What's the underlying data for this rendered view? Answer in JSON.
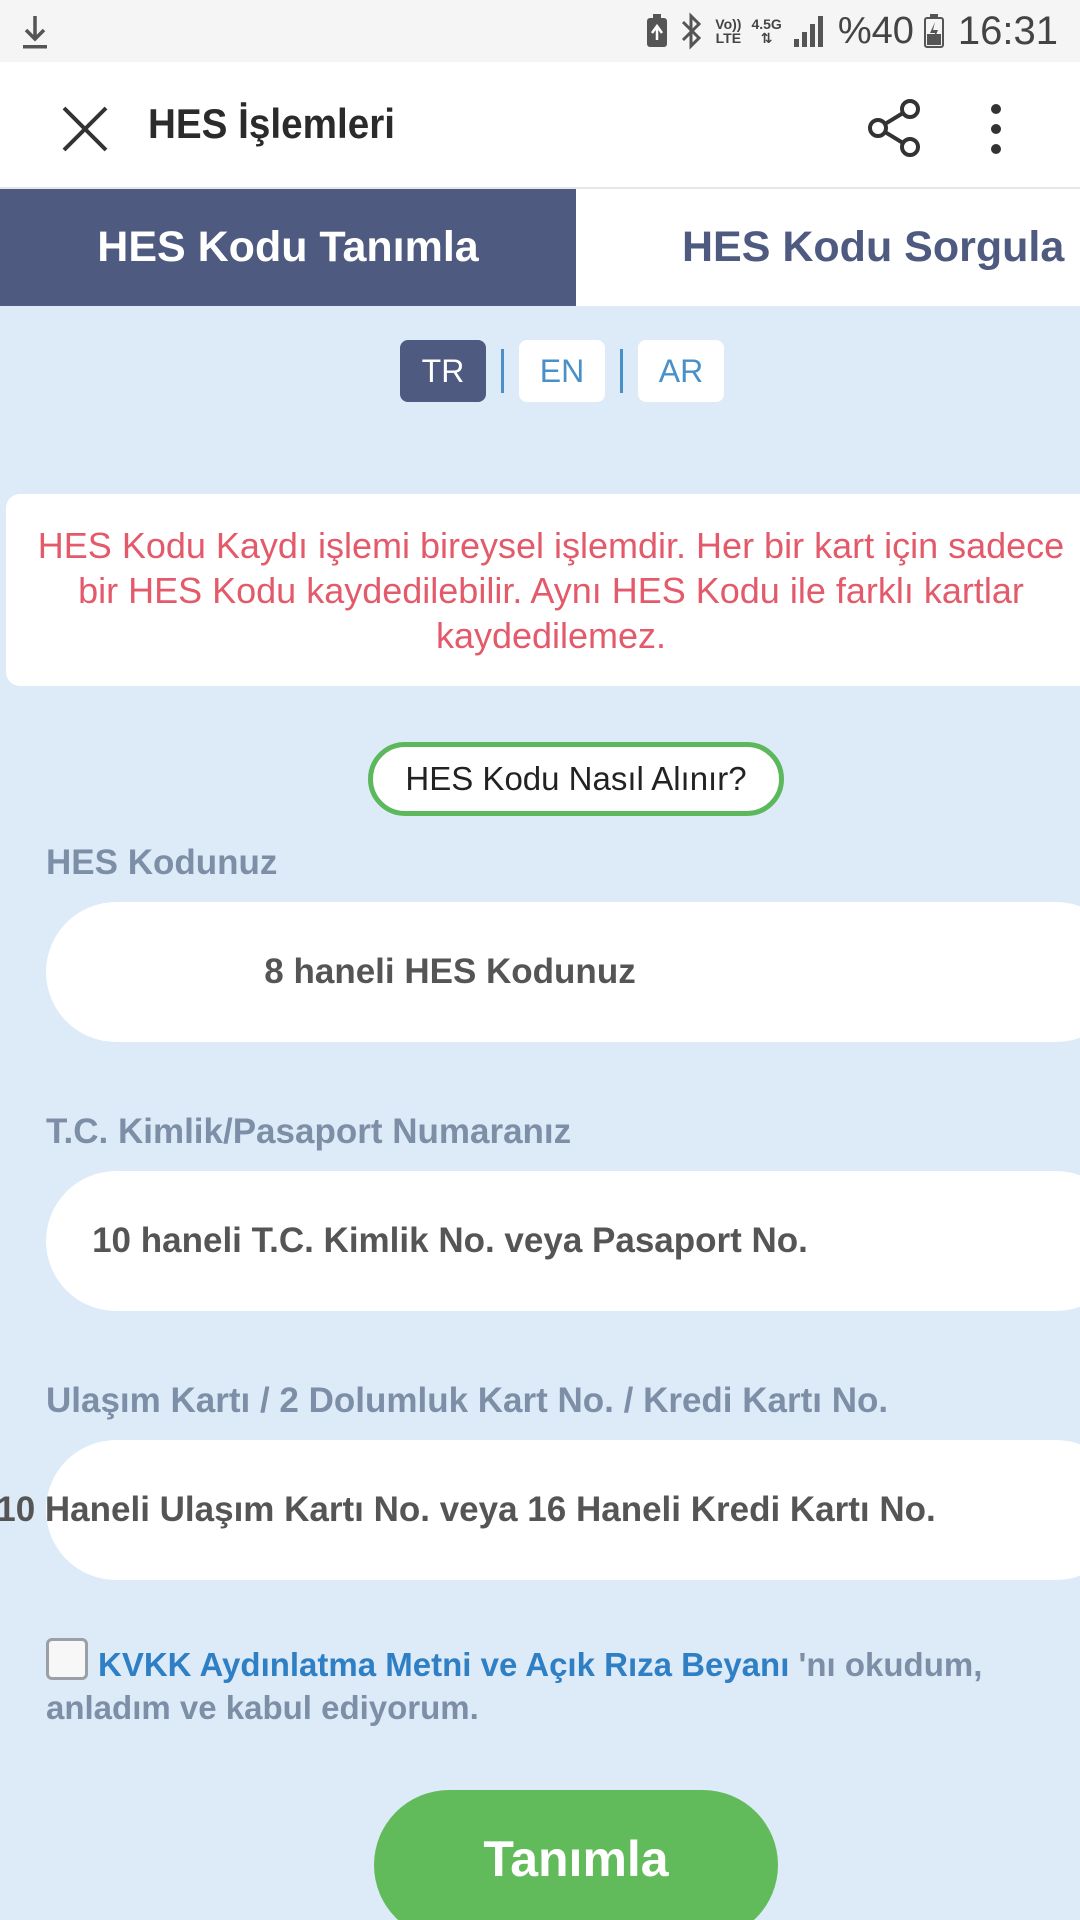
{
  "status_bar": {
    "network_top": "Vo))",
    "network_bottom": "LTE",
    "data_type": "4.5G",
    "battery": "%40",
    "time": "16:31",
    "icons": [
      "download-icon",
      "battery-saver-icon",
      "bluetooth-icon",
      "signal-icon",
      "battery-icon"
    ]
  },
  "app_bar": {
    "title": "HES İşlemleri",
    "icons": [
      "close-icon",
      "share-icon",
      "more-vertical-icon"
    ]
  },
  "tabs": [
    {
      "label": "HES Kodu Tanımla",
      "active": true
    },
    {
      "label": "HES Kodu Sorgula",
      "active": false
    }
  ],
  "languages": [
    {
      "code": "TR",
      "active": true
    },
    {
      "code": "EN",
      "active": false
    },
    {
      "code": "AR",
      "active": false
    }
  ],
  "info": {
    "message": "HES Kodu Kaydı işlemi bireysel işlemdir. Her bir kart için sadece bir HES Kodu kaydedilebilir. Aynı HES Kodu ile farklı kartlar kaydedilemez."
  },
  "how_button": {
    "label": "HES Kodu Nasıl Alınır?"
  },
  "form": {
    "hes_code": {
      "label": "HES Kodunuz",
      "placeholder": "8 haneli HES Kodunuz"
    },
    "identity": {
      "label": "T.C. Kimlik/Pasaport Numaranız",
      "placeholder": "10 haneli T.C. Kimlik No. veya Pasaport No."
    },
    "card": {
      "label": "Ulaşım Kartı / 2 Dolumluk Kart No. / Kredi Kartı No.",
      "placeholder": "10 Haneli Ulaşım Kartı No. veya 16 Haneli Kredi Kartı No."
    }
  },
  "consent": {
    "checked": false,
    "link_text": "KVKK Aydınlatma Metni ve Açık Rıza Beyanı",
    "suffix": " 'nı okudum, anladım ve kabul ediyorum."
  },
  "submit": {
    "label": "Tanımla"
  },
  "colors": {
    "primary": "#4e5a80",
    "background": "#ddeaf8",
    "accent_green": "#62bb5a",
    "warning_red": "#e35a6a",
    "link_blue": "#2f7fc4",
    "label_gray": "#7d8fa6"
  }
}
